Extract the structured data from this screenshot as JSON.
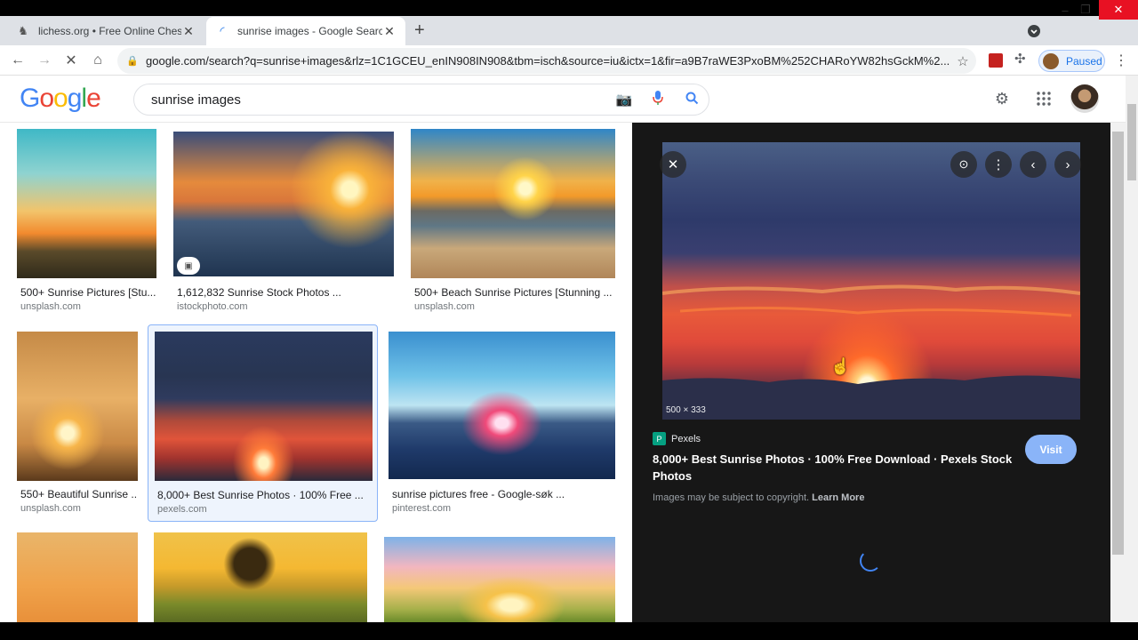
{
  "browser": {
    "tabs": [
      {
        "title": "lichess.org • Free Online Chess"
      },
      {
        "title": "sunrise images - Google Search"
      }
    ],
    "url": "google.com/search?q=sunrise+images&rlz=1C1GCEU_enIN908IN908&tbm=isch&source=iu&ictx=1&fir=a9B7raWE3PxoBM%252CHARoYW82hsGckM%2...",
    "profile_status": "Paused"
  },
  "header": {
    "logo_letters": [
      "G",
      "o",
      "o",
      "g",
      "l",
      "e"
    ],
    "logo_colors": [
      "#4285f4",
      "#ea4335",
      "#fbbc05",
      "#4285f4",
      "#34a853",
      "#ea4335"
    ],
    "search_query": "sunrise images"
  },
  "results": [
    {
      "caption": "500+ Sunrise Pictures [Stu...",
      "source": "unsplash.com"
    },
    {
      "caption": "1,612,832 Sunrise Stock Photos ...",
      "source": "istockphoto.com"
    },
    {
      "caption": "500+ Beach Sunrise Pictures [Stunning ...",
      "source": "unsplash.com"
    },
    {
      "caption": "550+ Beautiful Sunrise ...",
      "source": "unsplash.com"
    },
    {
      "caption": "8,000+ Best Sunrise Photos · 100% Free ...",
      "source": "pexels.com"
    },
    {
      "caption": "sunrise pictures free - Google-søk ...",
      "source": "pinterest.com"
    }
  ],
  "preview": {
    "dimensions": "500 × 333",
    "source_name": "Pexels",
    "title": "8,000+ Best Sunrise Photos · 100% Free Download · Pexels Stock Photos",
    "visit_label": "Visit",
    "copyright_text": "Images may be subject to copyright.",
    "learn_more": "Learn More"
  }
}
